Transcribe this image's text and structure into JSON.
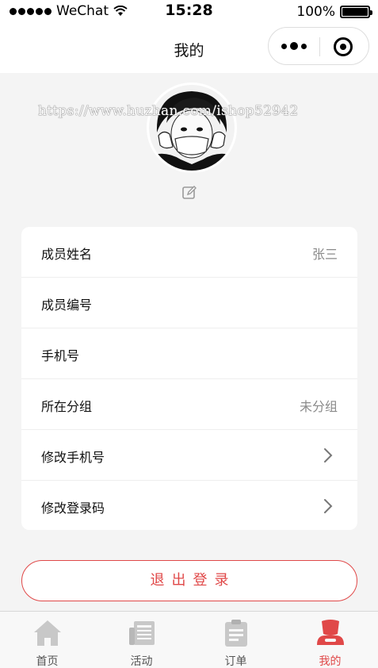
{
  "status_bar": {
    "carrier": "WeChat",
    "time": "15:28",
    "battery": "100%"
  },
  "nav": {
    "title": "我的"
  },
  "profile": {
    "watermark": "https://www.huzhan.com/ishop52942"
  },
  "info_rows": [
    {
      "label": "成员姓名",
      "value": "张三"
    },
    {
      "label": "成员编号",
      "value": ""
    },
    {
      "label": "手机号",
      "value": ""
    },
    {
      "label": "所在分组",
      "value": "未分组"
    },
    {
      "label": "修改手机号",
      "value": ""
    },
    {
      "label": "修改登录码",
      "value": ""
    }
  ],
  "logout_label": "退出登录",
  "tabs": [
    {
      "label": "首页",
      "icon": "home-icon"
    },
    {
      "label": "活动",
      "icon": "news-icon"
    },
    {
      "label": "订单",
      "icon": "clipboard-icon"
    },
    {
      "label": "我的",
      "icon": "user-icon"
    }
  ],
  "colors": {
    "accent": "#e04848",
    "tab_inactive": "#c8c8c8",
    "background": "#f4f4f4"
  }
}
